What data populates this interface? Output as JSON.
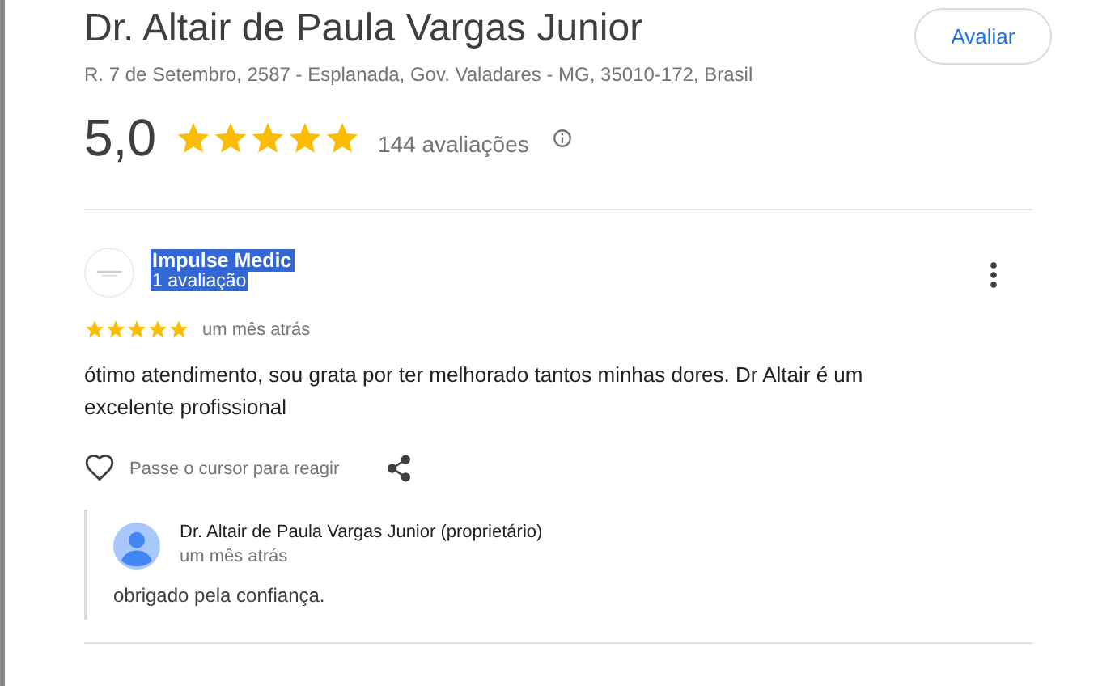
{
  "place": {
    "name": "Dr. Altair de Paula Vargas Junior",
    "address": "R. 7 de Setembro, 2587 - Esplanada, Gov. Valadares - MG, 35010-172, Brasil",
    "rating": "5,0",
    "stars": 5,
    "review_count": "144 avaliações"
  },
  "rate_button": "Avaliar",
  "reviews": [
    {
      "author": "Impulse Medic",
      "author_reviews": "1 avaliação",
      "highlighted": true,
      "stars": 5,
      "time": "um mês atrás",
      "text": "ótimo atendimento, sou grata por ter melhorado tantos minhas dores. Dr Altair é um excelente profissional",
      "react_hint": "Passe o cursor para reagir",
      "reply": {
        "author": "Dr. Altair de Paula Vargas Junior (proprietário)",
        "time": "um mês atrás",
        "text": "obrigado pela confiança."
      }
    }
  ]
}
